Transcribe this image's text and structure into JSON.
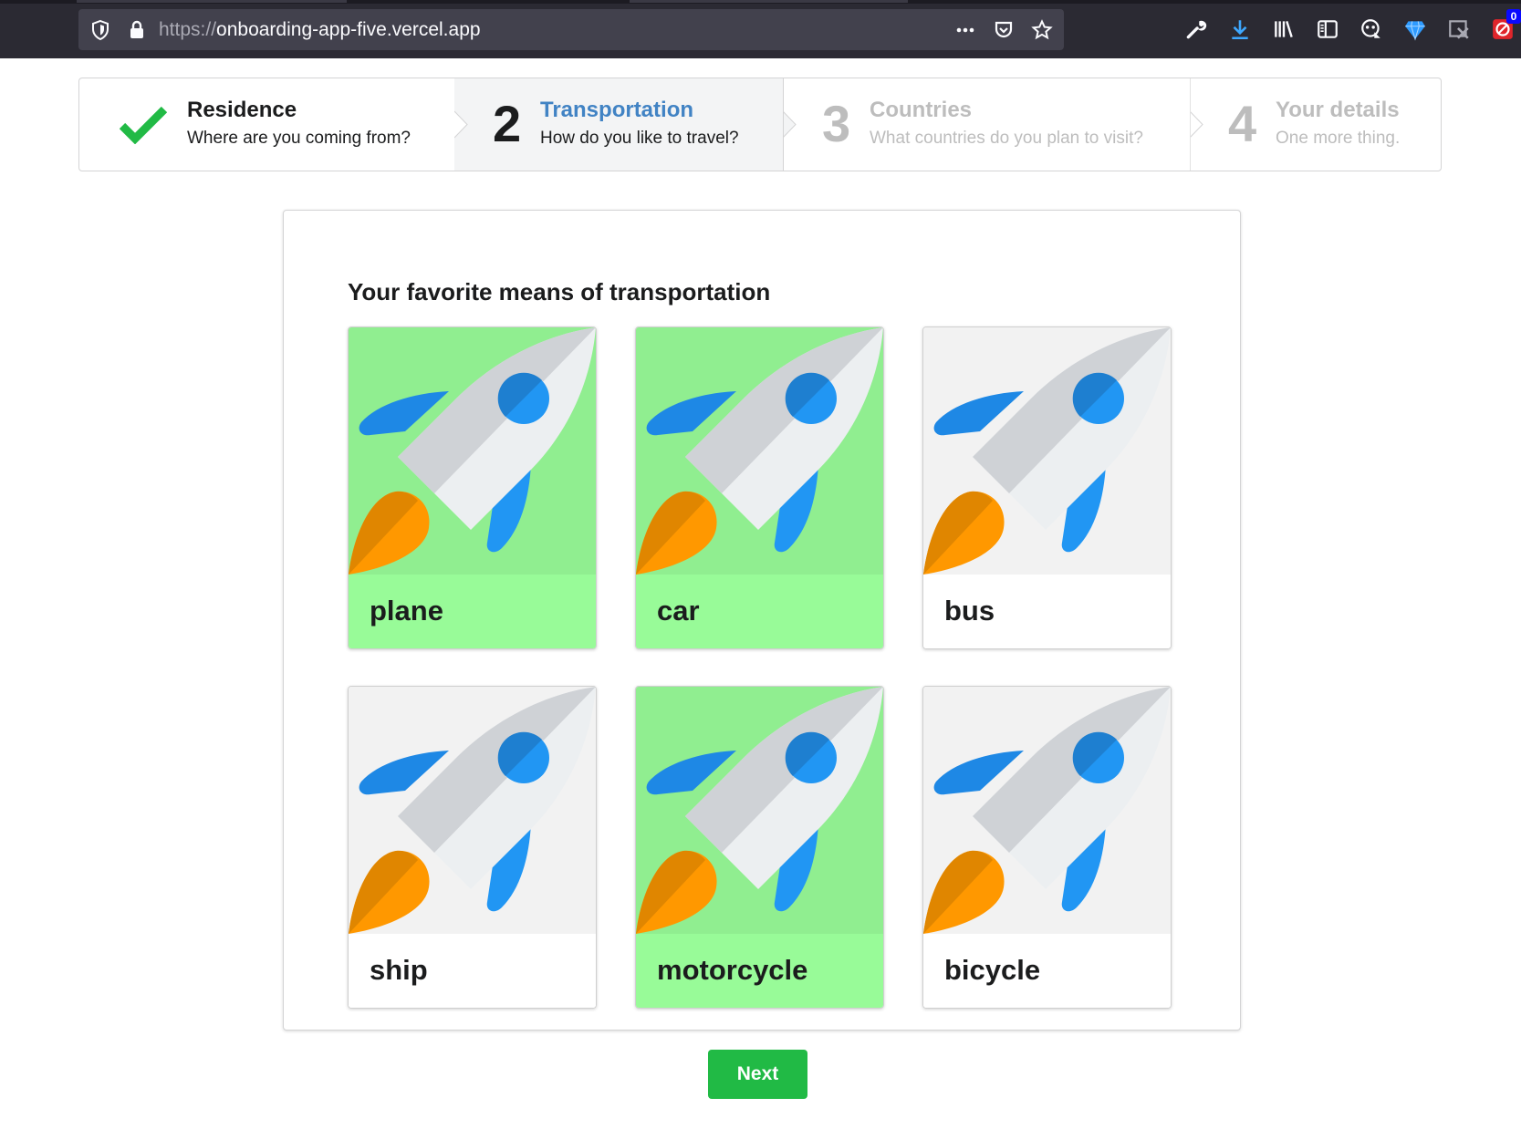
{
  "browser": {
    "url_scheme": "https://",
    "url_host": "onboarding-app-five.vercel.app",
    "badge_count": "0"
  },
  "steps": [
    {
      "number": "",
      "title": "Residence",
      "description": "Where are you coming from?",
      "state": "completed"
    },
    {
      "number": "2",
      "title": "Transportation",
      "description": "How do you like to travel?",
      "state": "active"
    },
    {
      "number": "3",
      "title": "Countries",
      "description": "What countries do you plan to visit?",
      "state": "disabled"
    },
    {
      "number": "4",
      "title": "Your details",
      "description": "One more thing.",
      "state": "disabled"
    }
  ],
  "main": {
    "heading": "Your favorite means of transportation",
    "options": [
      {
        "label": "plane",
        "selected": true,
        "icon": "rocket-icon"
      },
      {
        "label": "car",
        "selected": true,
        "icon": "rocket-icon"
      },
      {
        "label": "bus",
        "selected": false,
        "icon": "rocket-icon"
      },
      {
        "label": "ship",
        "selected": false,
        "icon": "rocket-icon"
      },
      {
        "label": "motorcycle",
        "selected": true,
        "icon": "rocket-icon"
      },
      {
        "label": "bicycle",
        "selected": false,
        "icon": "rocket-icon"
      }
    ],
    "next_label": "Next"
  },
  "colors": {
    "selected_image_bg": "#90ee90",
    "selected_label_bg": "#98fb98",
    "active_step_title": "#4183c4",
    "next_button": "#21ba45",
    "checkmark": "#21ba45"
  }
}
